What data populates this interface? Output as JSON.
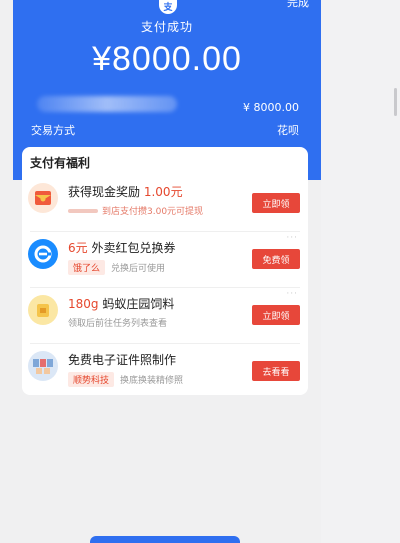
{
  "header": {
    "done_label": "完成",
    "alipay_glyph": "支",
    "status": "支付成功",
    "amount": "¥8000.00",
    "paid_amount": "¥ 8000.00",
    "method_label": "交易方式",
    "method_value": "花呗"
  },
  "benefits": {
    "title": "支付有福利",
    "items": [
      {
        "icon": "red-envelope-icon",
        "main_prefix": "获得现金奖励",
        "main_highlight": "1.00元",
        "main_suffix": "",
        "tag": "",
        "sub": "到店支付攒3.00元可提现",
        "button": "立即领"
      },
      {
        "icon": "eleme-icon",
        "main_prefix": "",
        "main_highlight": "6元",
        "main_suffix": " 外卖红包兑换券",
        "tag": "饿了么",
        "sub": "兑换后可使用",
        "button": "免费领"
      },
      {
        "icon": "feed-bag-icon",
        "main_prefix": "",
        "main_highlight": "180g",
        "main_suffix": " 蚂蚁庄园饲料",
        "tag": "",
        "sub": "领取后前往任务列表查看",
        "button": "立即领"
      },
      {
        "icon": "id-photo-icon",
        "main_prefix": "免费电子证件照制作",
        "main_highlight": "",
        "main_suffix": "",
        "tag": "顺势科技",
        "sub": "换底换装精修照",
        "button": "去看看"
      }
    ]
  },
  "colors": {
    "brand_blue": "#2f6ff0",
    "accent_red": "#e7473a"
  }
}
